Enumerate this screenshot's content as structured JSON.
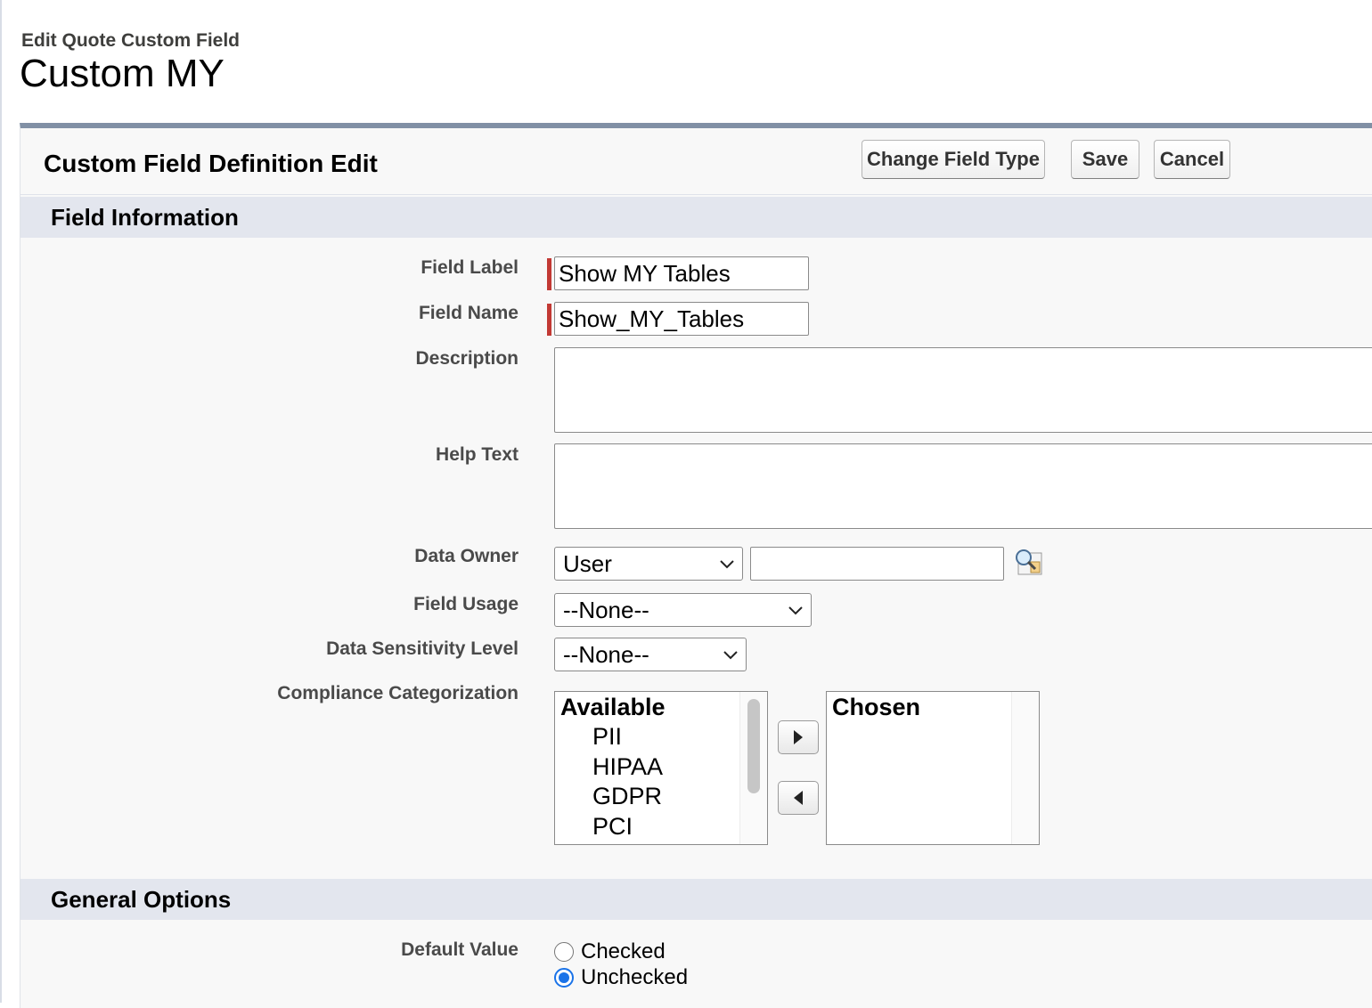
{
  "header": {
    "subtitle": "Edit Quote Custom Field",
    "title": "Custom MY"
  },
  "panel": {
    "title": "Custom Field Definition Edit",
    "buttons": {
      "change_type": "Change Field Type",
      "save": "Save",
      "cancel": "Cancel"
    }
  },
  "sections": {
    "field_info": "Field Information",
    "general_options": "General Options"
  },
  "fields": {
    "field_label": {
      "label": "Field Label",
      "value": "Show MY Tables"
    },
    "field_name": {
      "label": "Field Name",
      "value": "Show_MY_Tables"
    },
    "description": {
      "label": "Description",
      "value": ""
    },
    "help_text": {
      "label": "Help Text",
      "value": ""
    },
    "data_owner": {
      "label": "Data Owner",
      "type_value": "User",
      "value": ""
    },
    "field_usage": {
      "label": "Field Usage",
      "value": "--None--"
    },
    "data_sensitivity": {
      "label": "Data Sensitivity Level",
      "value": "--None--"
    },
    "compliance": {
      "label": "Compliance Categorization",
      "available_label": "Available",
      "available": [
        "PII",
        "HIPAA",
        "GDPR",
        "PCI"
      ],
      "chosen_label": "Chosen",
      "chosen": []
    },
    "default_value": {
      "label": "Default Value",
      "options": [
        {
          "label": "Checked",
          "selected": false
        },
        {
          "label": "Unchecked",
          "selected": true
        }
      ]
    }
  },
  "icons": {
    "lookup": "lookup-magnifier-icon",
    "add": "triangle-right-icon",
    "remove": "triangle-left-icon",
    "dropdown": "chevron-down-icon"
  },
  "colors": {
    "required": "#c23934",
    "section_bar": "#e3e6ee",
    "panel_top": "#8190a5",
    "radio_selected": "#1a73e8"
  }
}
